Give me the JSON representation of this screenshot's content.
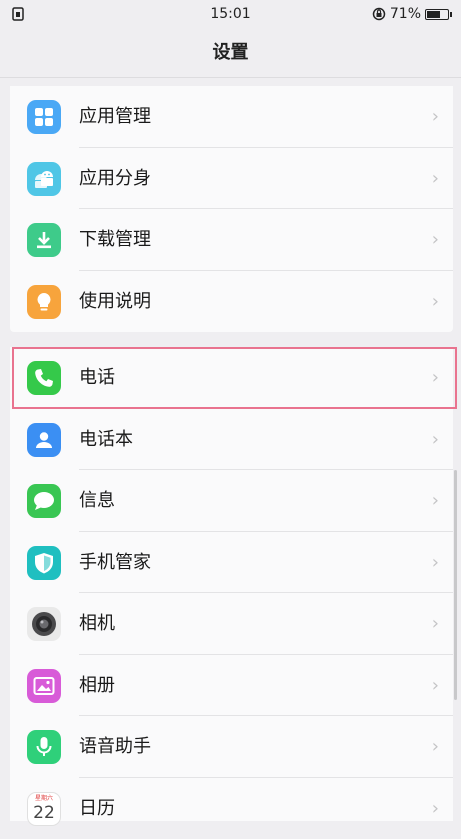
{
  "status": {
    "time": "15:01",
    "battery": "71%",
    "battery_level": 0.71
  },
  "title": "设置",
  "group1": [
    {
      "label": "应用管理",
      "icon": "app-grid-icon",
      "color": "#4aa8f5"
    },
    {
      "label": "应用分身",
      "icon": "android-clone-icon",
      "color": "#4fc6e6"
    },
    {
      "label": "下载管理",
      "icon": "download-icon",
      "color": "#3ecb8a"
    },
    {
      "label": "使用说明",
      "icon": "lightbulb-icon",
      "color": "#f7a43c"
    }
  ],
  "group2": [
    {
      "label": "电话",
      "icon": "phone-icon",
      "color": "#35c94a"
    },
    {
      "label": "电话本",
      "icon": "contacts-icon",
      "color": "#3b8ff3"
    },
    {
      "label": "信息",
      "icon": "message-icon",
      "color": "#39c653"
    },
    {
      "label": "手机管家",
      "icon": "shield-icon",
      "color": "#1fbfc0"
    },
    {
      "label": "相机",
      "icon": "camera-icon",
      "color": "#e9e9e9"
    },
    {
      "label": "相册",
      "icon": "gallery-icon",
      "color": "#d85bd8"
    },
    {
      "label": "语音助手",
      "icon": "microphone-icon",
      "color": "#2fd07a"
    },
    {
      "label": "日历",
      "icon": "calendar-icon",
      "color": "#ffffff",
      "calendar_weekday": "星期六",
      "calendar_day": "22"
    }
  ],
  "chevron": "›"
}
